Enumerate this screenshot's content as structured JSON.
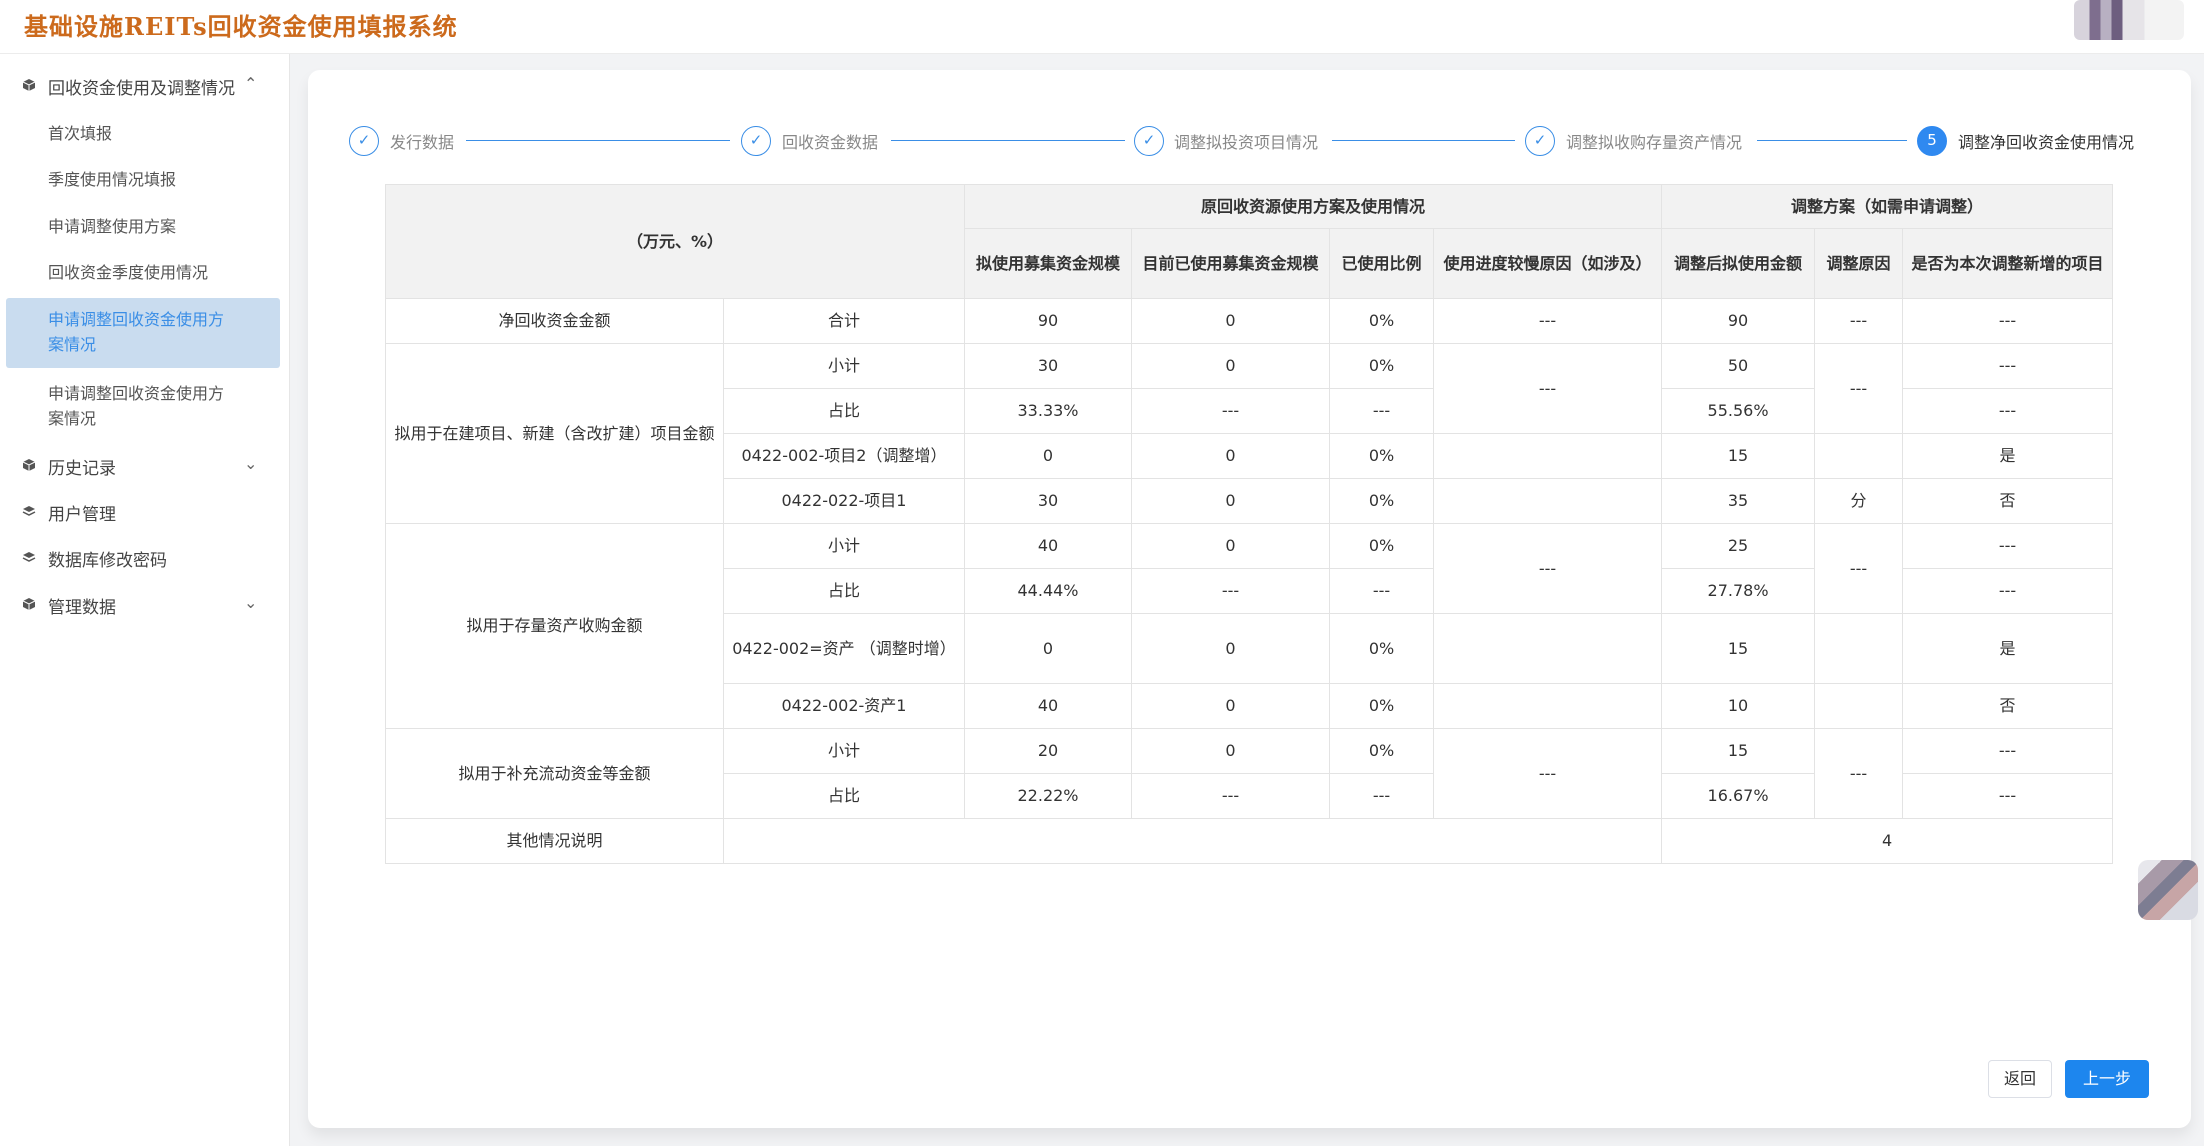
{
  "app": {
    "title": "基础设施REITs回收资金使用填报系统"
  },
  "sidebar": {
    "group1": {
      "label": "回收资金使用及调整情况",
      "arrow": "⌃"
    },
    "sub_items": [
      "首次填报",
      "季度使用情况填报",
      "申请调整使用方案",
      "回收资金季度使用情况",
      "申请调整回收资金使用方案情况",
      "申请调整回收资金使用方案情况"
    ],
    "group2": {
      "label": "历史记录",
      "arrow": "⌄"
    },
    "group3": {
      "label": "用户管理"
    },
    "group4": {
      "label": "数据库修改密码"
    },
    "group5": {
      "label": "管理数据",
      "arrow": "⌄"
    }
  },
  "steps": [
    {
      "label": "发行数据",
      "mark": "✓"
    },
    {
      "label": "回收资金数据",
      "mark": "✓"
    },
    {
      "label": "调整拟投资项目情况",
      "mark": "✓"
    },
    {
      "label": "调整拟收购存量资产情况",
      "mark": "✓"
    },
    {
      "label": "调整净回收资金使用情况",
      "mark": "5"
    }
  ],
  "table": {
    "unit_header": "（万元、%）",
    "group_original": "原回收资源使用方案及使用情况",
    "group_adjust": "调整方案（如需申请调整）",
    "cols": [
      "拟使用募集资金规模",
      "目前已使用募集资金规模",
      "已使用比例",
      "使用进度较慢原因（如涉及）",
      "调整后拟使用金额",
      "调整原因",
      "是否为本次调整新增的项目"
    ],
    "net_label": "净回收资金金额",
    "total_label": "合计",
    "net": [
      "90",
      "0",
      "0%",
      "---",
      "90",
      "---",
      "---"
    ],
    "cat1_label": "拟用于在建项目、新建（含改扩建）项目金额",
    "cat2_label": "拟用于存量资产收购金额",
    "cat3_label": "拟用于补充流动资金等金额",
    "subtotal_label": "小计",
    "ratio_label": "占比",
    "dash": "---",
    "c1_sub": [
      "30",
      "0",
      "0%",
      "50",
      "---"
    ],
    "c1_ratio": [
      "33.33%",
      "---",
      "---",
      "55.56%",
      "---"
    ],
    "c1_reason": "---",
    "c1_adj_reason": "---",
    "c1_p1": {
      "name": "0422-002-项目2（调整增）",
      "v": [
        "0",
        "0",
        "0%",
        "15",
        "是"
      ]
    },
    "c1_p2": {
      "name": "0422-022-项目1",
      "v": [
        "30",
        "0",
        "0%",
        "35",
        "分",
        "否"
      ]
    },
    "c2_sub": [
      "40",
      "0",
      "0%",
      "25",
      "---"
    ],
    "c2_ratio": [
      "44.44%",
      "---",
      "---",
      "27.78%",
      "---"
    ],
    "c2_reason": "---",
    "c2_adj_reason": "---",
    "c2_p1": {
      "name": "0422-002=资产 （调整时增）",
      "v": [
        "0",
        "0",
        "0%",
        "15",
        "是"
      ]
    },
    "c2_p2": {
      "name": "0422-002-资产1",
      "v": [
        "40",
        "0",
        "0%",
        "10",
        "否"
      ]
    },
    "c3_sub": [
      "20",
      "0",
      "0%",
      "15",
      "---"
    ],
    "c3_ratio": [
      "22.22%",
      "---",
      "---",
      "16.67%",
      "---"
    ],
    "c3_reason": "---",
    "c3_adj_reason": "---",
    "other_label": "其他情况说明",
    "other_value": "4"
  },
  "buttons": {
    "back": "返回",
    "prev": "上一步"
  },
  "colors": {
    "primary": "#1d86ee",
    "title_orange": "#cc6a1c",
    "active_bg": "#c9dcef"
  }
}
